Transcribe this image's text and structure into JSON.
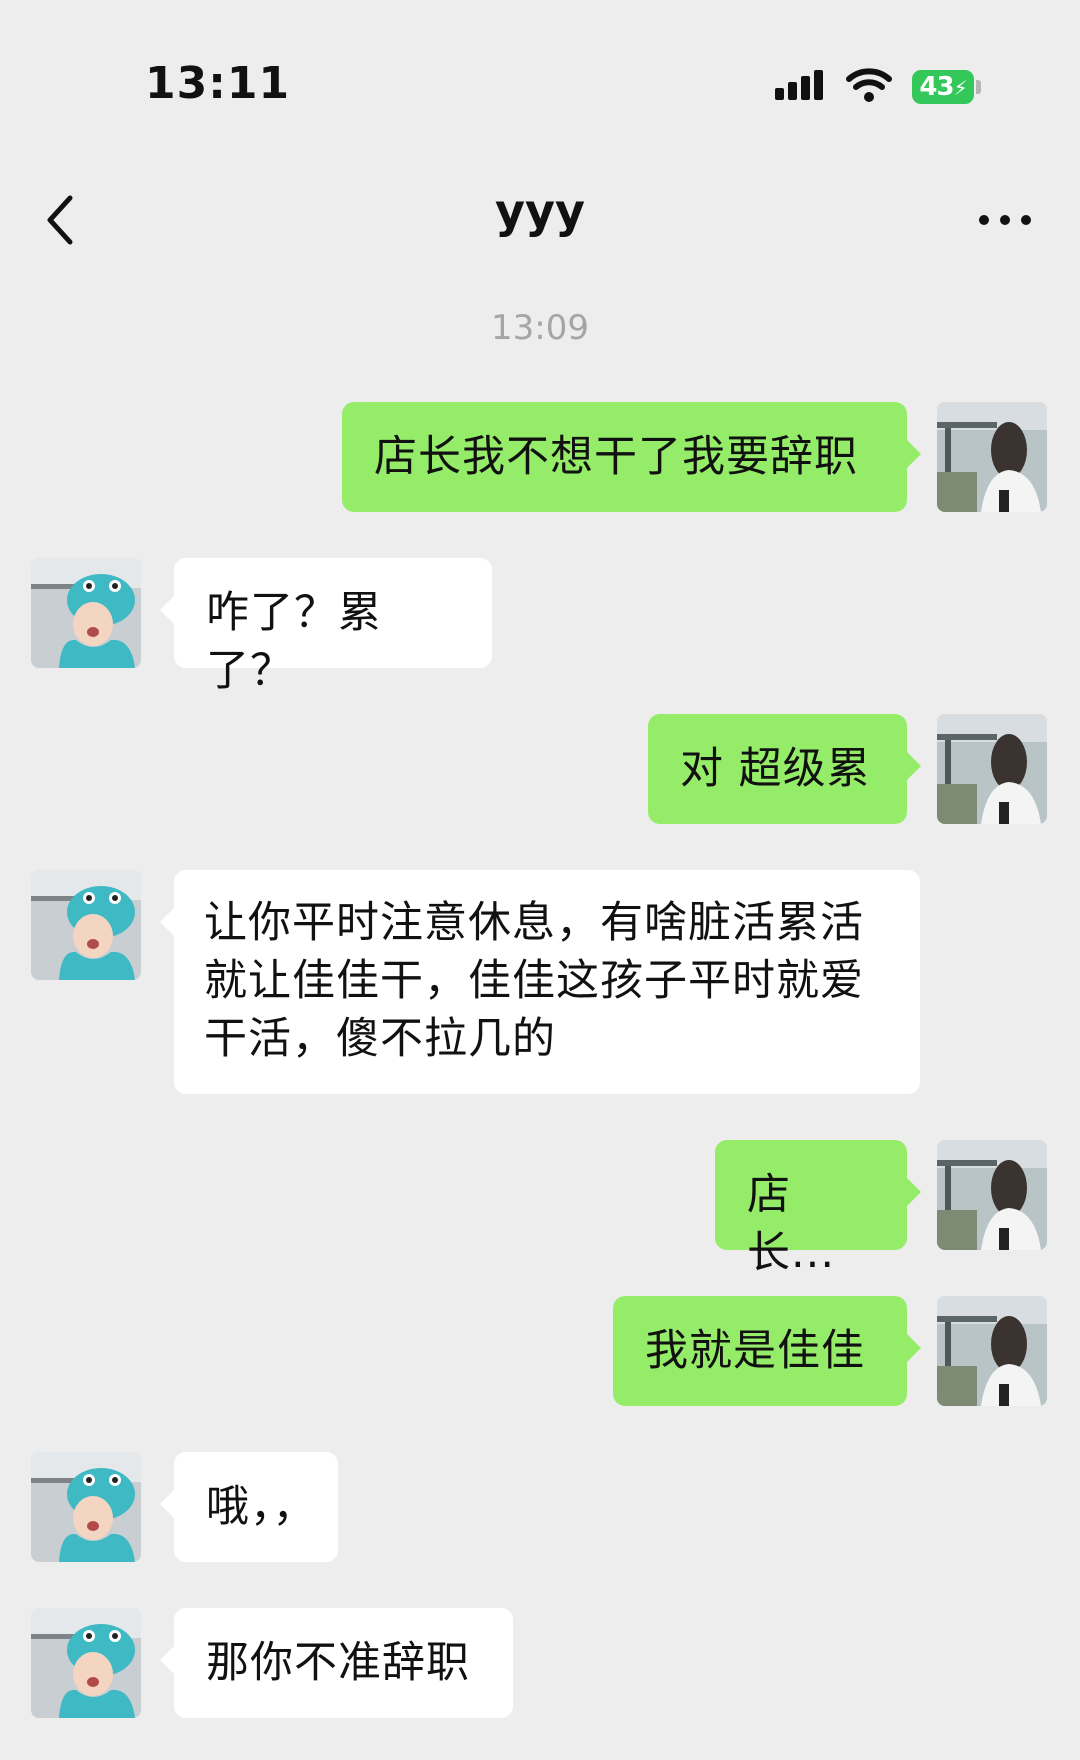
{
  "status_bar": {
    "time": "13:11",
    "battery": "43",
    "signal_icon": "cellular-signal-icon",
    "wifi_icon": "wifi-icon"
  },
  "nav": {
    "title": "yyy",
    "back_icon": "chevron-left-icon",
    "more_icon": "more-dots-icon"
  },
  "chat": {
    "timestamp": "13:09",
    "messages": [
      {
        "side": "out",
        "text": "店长我不想干了我要辞职"
      },
      {
        "side": "in",
        "text": "咋了？累了？"
      },
      {
        "side": "out",
        "text": "对 超级累"
      },
      {
        "side": "in",
        "text": "让你平时注意休息，有啥脏活累活就让佳佳干，佳佳这孩子平时就爱干活，傻不拉几的"
      },
      {
        "side": "out",
        "text": "店长..."
      },
      {
        "side": "out",
        "text": "我就是佳佳"
      },
      {
        "side": "in",
        "text": "哦，，"
      },
      {
        "side": "in",
        "text": "那你不准辞职"
      }
    ]
  },
  "colors": {
    "background": "#ededed",
    "outgoing_bubble": "#95ec69",
    "incoming_bubble": "#ffffff",
    "battery": "#34c759"
  }
}
